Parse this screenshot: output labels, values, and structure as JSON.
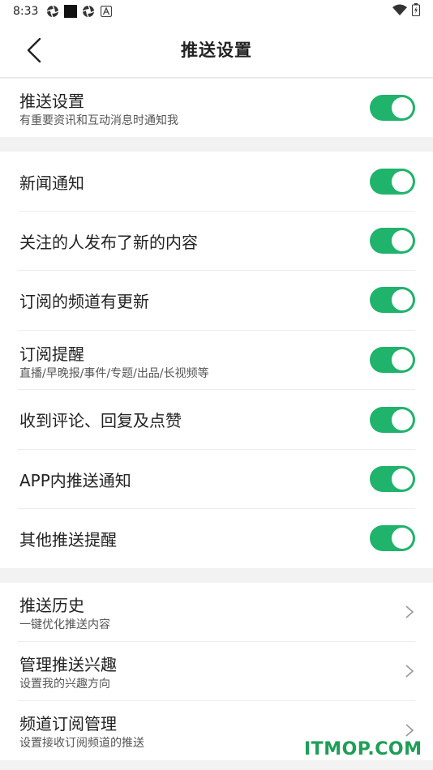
{
  "status_bar": {
    "time": "8:33",
    "icons": [
      "aperture-icon",
      "black-square-icon",
      "aperture-icon",
      "a-badge-icon"
    ],
    "right_icons": [
      "wifi-icon",
      "battery-charging-icon"
    ]
  },
  "header": {
    "back_icon": "chevron-left-icon",
    "title": "推送设置"
  },
  "section_main": {
    "label": "推送设置",
    "sub": "有重要资讯和互动消息时通知我",
    "enabled": true
  },
  "notifications": [
    {
      "label": "新闻通知",
      "enabled": true
    },
    {
      "label": "关注的人发布了新的内容",
      "enabled": true
    },
    {
      "label": "订阅的频道有更新",
      "enabled": true
    },
    {
      "label": "订阅提醒",
      "sub": "直播/早晚报/事件/专题/出品/长视频等",
      "enabled": true
    },
    {
      "label": "收到评论、回复及点赞",
      "enabled": true
    },
    {
      "label": "APP内推送通知",
      "enabled": true
    },
    {
      "label": "其他推送提醒",
      "enabled": true
    }
  ],
  "links": [
    {
      "label": "推送历史",
      "sub": "一键优化推送内容"
    },
    {
      "label": "管理推送兴趣",
      "sub": "设置我的兴趣方向"
    },
    {
      "label": "频道订阅管理",
      "sub": "设置接收订阅频道的推送"
    }
  ],
  "watermark": "ITMOP.COM",
  "colors": {
    "toggle_on": "#1fb36b",
    "watermark": "#1e9e57"
  }
}
